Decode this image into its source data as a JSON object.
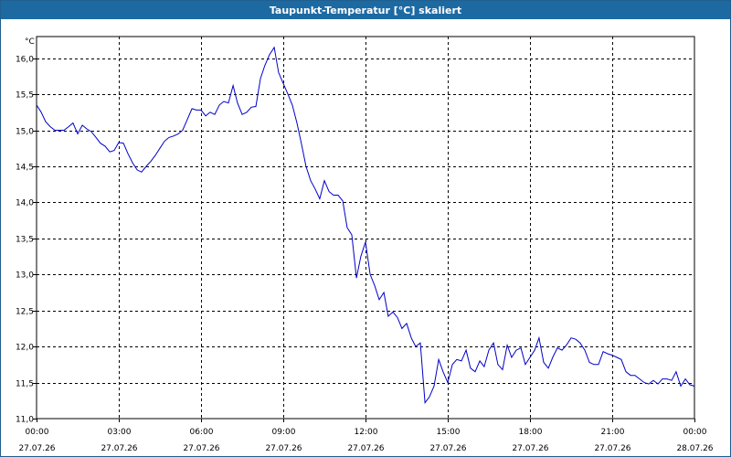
{
  "window": {
    "title": "Taupunkt-Temperatur [°C] skaliert"
  },
  "chart_data": {
    "type": "line",
    "title": "Taupunkt-Temperatur [°C] skaliert",
    "ylabel": "°C",
    "ylim": [
      11.0,
      16.3
    ],
    "yticks": [
      "16,0",
      "15,5",
      "15,0",
      "14,5",
      "14,0",
      "13,5",
      "13,0",
      "12,5",
      "12,0",
      "11,5",
      "11,0"
    ],
    "ytick_values": [
      16.0,
      15.5,
      15.0,
      14.5,
      14.0,
      13.5,
      13.0,
      12.5,
      12.0,
      11.5,
      11.0
    ],
    "xlim": [
      0,
      24
    ],
    "xticks": [
      {
        "x": 0,
        "time": "00:00",
        "date": "27.07.26"
      },
      {
        "x": 3,
        "time": "03:00",
        "date": "27.07.26"
      },
      {
        "x": 6,
        "time": "06:00",
        "date": "27.07.26"
      },
      {
        "x": 9,
        "time": "09:00",
        "date": "27.07.26"
      },
      {
        "x": 12,
        "time": "12:00",
        "date": "27.07.26"
      },
      {
        "x": 15,
        "time": "15:00",
        "date": "27.07.26"
      },
      {
        "x": 18,
        "time": "18:00",
        "date": "27.07.26"
      },
      {
        "x": 21,
        "time": "21:00",
        "date": "27.07.26"
      },
      {
        "x": 24,
        "time": "00:00",
        "date": "28.07.26"
      }
    ],
    "grid": true,
    "line_color": "#0000c8",
    "series": [
      {
        "values": [
          [
            0.0,
            15.35
          ],
          [
            0.17,
            15.25
          ],
          [
            0.33,
            15.12
          ],
          [
            0.5,
            15.05
          ],
          [
            0.67,
            15.0
          ],
          [
            0.83,
            15.0
          ],
          [
            1.0,
            15.0
          ],
          [
            1.17,
            15.05
          ],
          [
            1.33,
            15.1
          ],
          [
            1.5,
            14.95
          ],
          [
            1.67,
            15.07
          ],
          [
            1.83,
            15.02
          ],
          [
            2.0,
            14.98
          ],
          [
            2.17,
            14.9
          ],
          [
            2.33,
            14.82
          ],
          [
            2.5,
            14.78
          ],
          [
            2.67,
            14.7
          ],
          [
            2.83,
            14.72
          ],
          [
            3.0,
            14.83
          ],
          [
            3.17,
            14.82
          ],
          [
            3.33,
            14.68
          ],
          [
            3.5,
            14.55
          ],
          [
            3.67,
            14.45
          ],
          [
            3.83,
            14.42
          ],
          [
            4.0,
            14.5
          ],
          [
            4.17,
            14.57
          ],
          [
            4.33,
            14.65
          ],
          [
            4.5,
            14.75
          ],
          [
            4.67,
            14.85
          ],
          [
            4.83,
            14.9
          ],
          [
            5.0,
            14.92
          ],
          [
            5.17,
            14.95
          ],
          [
            5.33,
            15.0
          ],
          [
            5.5,
            15.15
          ],
          [
            5.67,
            15.3
          ],
          [
            5.83,
            15.28
          ],
          [
            6.0,
            15.28
          ],
          [
            6.17,
            15.2
          ],
          [
            6.33,
            15.25
          ],
          [
            6.5,
            15.22
          ],
          [
            6.67,
            15.35
          ],
          [
            6.83,
            15.4
          ],
          [
            7.0,
            15.38
          ],
          [
            7.17,
            15.62
          ],
          [
            7.33,
            15.38
          ],
          [
            7.5,
            15.22
          ],
          [
            7.67,
            15.25
          ],
          [
            7.83,
            15.32
          ],
          [
            8.0,
            15.33
          ],
          [
            8.17,
            15.72
          ],
          [
            8.33,
            15.9
          ],
          [
            8.5,
            16.05
          ],
          [
            8.67,
            16.15
          ],
          [
            8.83,
            15.8
          ],
          [
            9.0,
            15.65
          ],
          [
            9.17,
            15.5
          ],
          [
            9.33,
            15.35
          ],
          [
            9.5,
            15.1
          ],
          [
            9.67,
            14.8
          ],
          [
            9.83,
            14.5
          ],
          [
            10.0,
            14.3
          ],
          [
            10.17,
            14.18
          ],
          [
            10.33,
            14.05
          ],
          [
            10.5,
            14.3
          ],
          [
            10.67,
            14.15
          ],
          [
            10.83,
            14.1
          ],
          [
            11.0,
            14.1
          ],
          [
            11.17,
            14.02
          ],
          [
            11.33,
            13.65
          ],
          [
            11.5,
            13.55
          ],
          [
            11.67,
            12.95
          ],
          [
            11.83,
            13.25
          ],
          [
            12.0,
            13.45
          ],
          [
            12.17,
            13.0
          ],
          [
            12.33,
            12.85
          ],
          [
            12.5,
            12.65
          ],
          [
            12.67,
            12.75
          ],
          [
            12.83,
            12.42
          ],
          [
            13.0,
            12.48
          ],
          [
            13.17,
            12.4
          ],
          [
            13.33,
            12.25
          ],
          [
            13.5,
            12.32
          ],
          [
            13.67,
            12.12
          ],
          [
            13.83,
            12.0
          ],
          [
            14.0,
            12.05
          ],
          [
            14.17,
            11.22
          ],
          [
            14.33,
            11.3
          ],
          [
            14.5,
            11.45
          ],
          [
            14.67,
            11.82
          ],
          [
            14.83,
            11.65
          ],
          [
            15.0,
            11.5
          ],
          [
            15.17,
            11.75
          ],
          [
            15.33,
            11.82
          ],
          [
            15.5,
            11.8
          ],
          [
            15.67,
            11.95
          ],
          [
            15.83,
            11.7
          ],
          [
            16.0,
            11.65
          ],
          [
            16.17,
            11.8
          ],
          [
            16.33,
            11.72
          ],
          [
            16.5,
            11.95
          ],
          [
            16.67,
            12.05
          ],
          [
            16.83,
            11.75
          ],
          [
            17.0,
            11.68
          ],
          [
            17.17,
            12.02
          ],
          [
            17.33,
            11.85
          ],
          [
            17.5,
            11.95
          ],
          [
            17.67,
            11.98
          ],
          [
            17.83,
            11.75
          ],
          [
            18.0,
            11.85
          ],
          [
            18.17,
            11.95
          ],
          [
            18.33,
            12.12
          ],
          [
            18.5,
            11.78
          ],
          [
            18.67,
            11.7
          ],
          [
            18.83,
            11.85
          ],
          [
            19.0,
            11.98
          ],
          [
            19.17,
            11.95
          ],
          [
            19.33,
            12.02
          ],
          [
            19.5,
            12.12
          ],
          [
            19.67,
            12.1
          ],
          [
            19.83,
            12.05
          ],
          [
            20.0,
            11.95
          ],
          [
            20.17,
            11.78
          ],
          [
            20.33,
            11.75
          ],
          [
            20.5,
            11.75
          ],
          [
            20.67,
            11.93
          ],
          [
            20.83,
            11.9
          ],
          [
            21.0,
            11.88
          ],
          [
            21.17,
            11.85
          ],
          [
            21.33,
            11.82
          ],
          [
            21.5,
            11.65
          ],
          [
            21.67,
            11.6
          ],
          [
            21.83,
            11.6
          ],
          [
            22.0,
            11.55
          ],
          [
            22.17,
            11.5
          ],
          [
            22.33,
            11.48
          ],
          [
            22.5,
            11.53
          ],
          [
            22.67,
            11.48
          ],
          [
            22.83,
            11.55
          ],
          [
            23.0,
            11.55
          ],
          [
            23.17,
            11.53
          ],
          [
            23.33,
            11.65
          ],
          [
            23.5,
            11.45
          ],
          [
            23.67,
            11.55
          ],
          [
            23.83,
            11.47
          ],
          [
            24.0,
            11.45
          ]
        ]
      }
    ]
  }
}
